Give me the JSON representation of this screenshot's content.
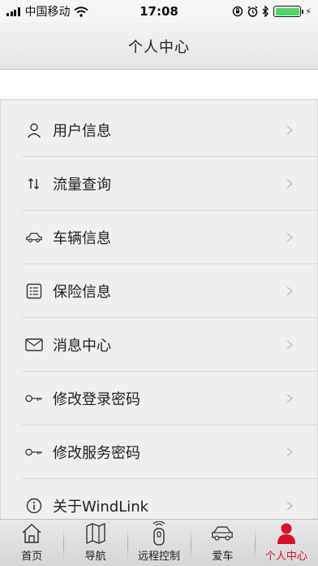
{
  "status_bar": {
    "carrier": "中国移动",
    "time": "17:08",
    "charging": "⚡"
  },
  "nav": {
    "title": "个人中心"
  },
  "menu": {
    "items": [
      {
        "label": "用户信息",
        "icon": "user-icon"
      },
      {
        "label": "流量查询",
        "icon": "data-transfer-icon"
      },
      {
        "label": "车辆信息",
        "icon": "car-icon"
      },
      {
        "label": "保险信息",
        "icon": "list-icon"
      },
      {
        "label": "消息中心",
        "icon": "envelope-icon"
      },
      {
        "label": "修改登录密码",
        "icon": "key-icon"
      },
      {
        "label": "修改服务密码",
        "icon": "key-icon"
      },
      {
        "label": "关于WindLink",
        "icon": "info-icon"
      }
    ]
  },
  "tabbar": {
    "active_color": "#d8112a",
    "tabs": [
      {
        "label": "首页",
        "icon": "home-icon"
      },
      {
        "label": "导航",
        "icon": "map-icon"
      },
      {
        "label": "远程控制",
        "icon": "remote-key-icon"
      },
      {
        "label": "爱车",
        "icon": "car-icon"
      },
      {
        "label": "个人中心",
        "icon": "person-icon",
        "active": true
      }
    ]
  }
}
